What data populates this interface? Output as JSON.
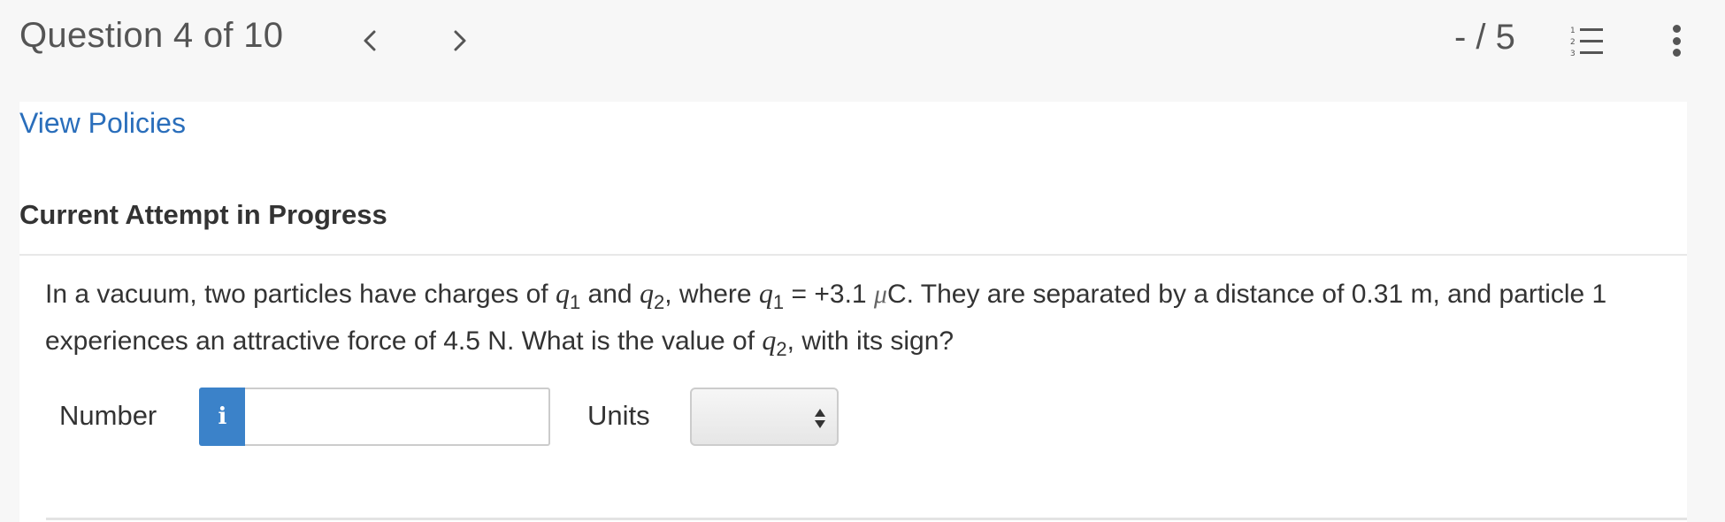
{
  "header": {
    "question_title": "Question 4 of 10",
    "score": "- / 5"
  },
  "links": {
    "view_policies": "View Policies"
  },
  "attempt": {
    "heading": "Current Attempt in Progress"
  },
  "question": {
    "text_1": "In a vacuum, two particles have charges of ",
    "q": "q",
    "sub1": "1",
    "sub2": "2",
    "and": " and ",
    "where": ", where ",
    "eq": " = +3.1 ",
    "mu": "μ",
    "text_2": "C. They are separated by a distance of 0.31 m, and particle 1 experiences an attractive force of 4.5 N. What is the value of ",
    "text_3": ", with its sign?"
  },
  "answer": {
    "number_label": "Number",
    "info_icon_glyph": "i",
    "number_value": "",
    "units_label": "Units",
    "units_selected": ""
  },
  "icons": {
    "prev": "chevron-left-icon",
    "next": "chevron-right-icon",
    "list": "numbered-list-icon",
    "more": "more-vertical-icon"
  },
  "colors": {
    "link": "#2a6ebb",
    "info_button": "#3b82c9"
  }
}
